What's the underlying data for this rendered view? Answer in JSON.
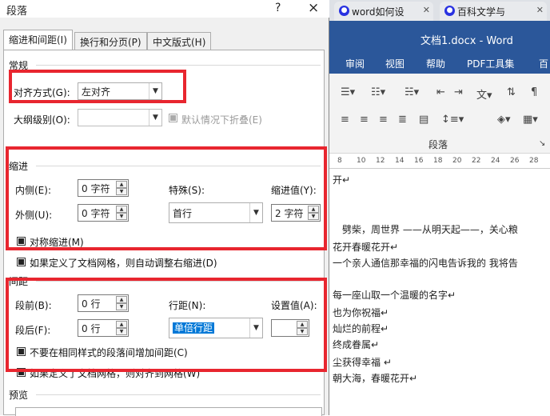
{
  "browser": {
    "tabs": [
      {
        "title": "word如何设"
      },
      {
        "title": "百科文学与"
      }
    ]
  },
  "word": {
    "title": "文档1.docx - Word",
    "ribbon_tabs": [
      "审阅",
      "视图",
      "帮助",
      "PDF工具集",
      "百"
    ],
    "group_label": "段落",
    "ruler": [
      "8",
      "10",
      "12",
      "14",
      "16",
      "18",
      "20",
      "22",
      "24",
      "26",
      "28"
    ],
    "doc_lines": [
      "开↵",
      "劈柴，周世界 ——从明天起——，关心粮",
      "花开春暖花开↵",
      "一个亲人通信那幸福的闪电告诉我的 我将告",
      "每一座山取一个温暖的名字↵",
      "也为你祝福↵",
      "灿烂的前程↵",
      "终成眷属↵",
      "尘获得幸福 ↵",
      "朝大海，春暖花开↵"
    ]
  },
  "dialog": {
    "title": "段落",
    "help": "?",
    "close": "×",
    "tabs": [
      "缩进和间距(I)",
      "换行和分页(P)",
      "中文版式(H)"
    ],
    "general": {
      "section": "常规",
      "alignment_label": "对齐方式(G):",
      "alignment_value": "左对齐",
      "outline_label": "大纲级别(O):",
      "outline_value": "",
      "collapse_label": "默认情况下折叠(E)",
      "collapse_checked": true
    },
    "indent": {
      "section": "缩进",
      "inside_label": "内侧(E):",
      "inside_value": "0 字符",
      "outside_label": "外侧(U):",
      "outside_value": "0 字符",
      "special_label": "特殊(S):",
      "special_value": "首行",
      "by_label": "缩进值(Y):",
      "by_value": "2 字符",
      "mirror_label": "对称缩进(M)",
      "mirror_checked": true,
      "grid_label": "如果定义了文档网格，则自动调整右缩进(D)",
      "grid_checked": true
    },
    "spacing": {
      "section": "间距",
      "before_label": "段前(B):",
      "before_value": "0 行",
      "after_label": "段后(F):",
      "after_value": "0 行",
      "line_label": "行距(N):",
      "line_value": "单倍行距",
      "at_label": "设置值(A):",
      "at_value": "",
      "no_space_label": "不要在相同样式的段落间增加间距(C)",
      "no_space_checked": true,
      "snap_label": "如果定义了文档网格，则对齐到网格(W)",
      "snap_checked": true
    },
    "preview": {
      "section": "预览"
    }
  },
  "colors": {
    "highlight": "#e8262f",
    "word_blue": "#2b579a",
    "selection": "#0078d7"
  }
}
